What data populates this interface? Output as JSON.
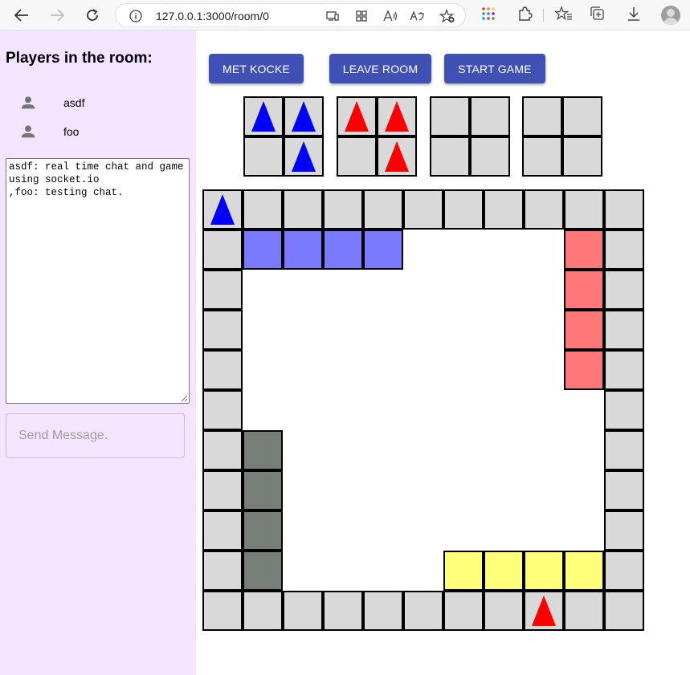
{
  "browser": {
    "url": "127.0.0.1:3000/room/0"
  },
  "sidebar": {
    "title": "Players in the room:",
    "players": [
      {
        "name": "asdf"
      },
      {
        "name": "foo"
      }
    ],
    "chat_log": "asdf: real time chat and game using socket.io\n,foo: testing chat.",
    "send_placeholder": "Send Message."
  },
  "controls": {
    "roll_label": "MET KOCKE",
    "leave_label": "LEAVE ROOM",
    "start_label": "START GAME"
  },
  "colors": {
    "cell_gray": "#d9d9d9",
    "blue_home": "#7a7aff",
    "red_home": "#ff7878",
    "yellow_home": "#ffff7a",
    "dark_home": "#777d77",
    "blue_pawn": "#0000ff",
    "red_pawn": "#ff0000",
    "button": "#3f51b5",
    "sidebar_bg": "#f3e5ff"
  },
  "board": {
    "bases": [
      {
        "color": "blue",
        "pawns": [
          true,
          true,
          false,
          true
        ]
      },
      {
        "color": "red",
        "pawns": [
          true,
          true,
          false,
          true
        ]
      },
      {
        "color": "none",
        "pawns": [
          false,
          false,
          false,
          false
        ]
      },
      {
        "color": "none",
        "pawns": [
          false,
          false,
          false,
          false
        ]
      }
    ],
    "path_cells": [
      {
        "r": 0,
        "c": 0,
        "pawn": "blue"
      },
      {
        "r": 0,
        "c": 1
      },
      {
        "r": 0,
        "c": 2
      },
      {
        "r": 0,
        "c": 3
      },
      {
        "r": 0,
        "c": 4
      },
      {
        "r": 0,
        "c": 5
      },
      {
        "r": 0,
        "c": 6
      },
      {
        "r": 0,
        "c": 7
      },
      {
        "r": 0,
        "c": 8
      },
      {
        "r": 0,
        "c": 9
      },
      {
        "r": 0,
        "c": 10
      },
      {
        "r": 1,
        "c": 0
      },
      {
        "r": 1,
        "c": 10
      },
      {
        "r": 2,
        "c": 0
      },
      {
        "r": 2,
        "c": 10
      },
      {
        "r": 3,
        "c": 0
      },
      {
        "r": 3,
        "c": 10
      },
      {
        "r": 4,
        "c": 0
      },
      {
        "r": 4,
        "c": 10
      },
      {
        "r": 5,
        "c": 0
      },
      {
        "r": 5,
        "c": 10
      },
      {
        "r": 6,
        "c": 0
      },
      {
        "r": 6,
        "c": 10
      },
      {
        "r": 7,
        "c": 0
      },
      {
        "r": 7,
        "c": 10
      },
      {
        "r": 8,
        "c": 0
      },
      {
        "r": 8,
        "c": 10
      },
      {
        "r": 9,
        "c": 0
      },
      {
        "r": 9,
        "c": 10
      },
      {
        "r": 10,
        "c": 0
      },
      {
        "r": 10,
        "c": 1
      },
      {
        "r": 10,
        "c": 2
      },
      {
        "r": 10,
        "c": 3
      },
      {
        "r": 10,
        "c": 4
      },
      {
        "r": 10,
        "c": 5
      },
      {
        "r": 10,
        "c": 6
      },
      {
        "r": 10,
        "c": 7
      },
      {
        "r": 10,
        "c": 8,
        "pawn": "red"
      },
      {
        "r": 10,
        "c": 9
      },
      {
        "r": 10,
        "c": 10
      }
    ],
    "home_cells": [
      {
        "r": 1,
        "c": 1,
        "color": "blue"
      },
      {
        "r": 1,
        "c": 2,
        "color": "blue"
      },
      {
        "r": 1,
        "c": 3,
        "color": "blue"
      },
      {
        "r": 1,
        "c": 4,
        "color": "blue"
      },
      {
        "r": 1,
        "c": 9,
        "color": "red"
      },
      {
        "r": 2,
        "c": 9,
        "color": "red"
      },
      {
        "r": 3,
        "c": 9,
        "color": "red"
      },
      {
        "r": 4,
        "c": 9,
        "color": "red"
      },
      {
        "r": 9,
        "c": 6,
        "color": "yellow"
      },
      {
        "r": 9,
        "c": 7,
        "color": "yellow"
      },
      {
        "r": 9,
        "c": 8,
        "color": "yellow"
      },
      {
        "r": 9,
        "c": 9,
        "color": "yellow"
      },
      {
        "r": 6,
        "c": 1,
        "color": "dark"
      },
      {
        "r": 7,
        "c": 1,
        "color": "dark"
      },
      {
        "r": 8,
        "c": 1,
        "color": "dark"
      },
      {
        "r": 9,
        "c": 1,
        "color": "dark"
      }
    ]
  }
}
